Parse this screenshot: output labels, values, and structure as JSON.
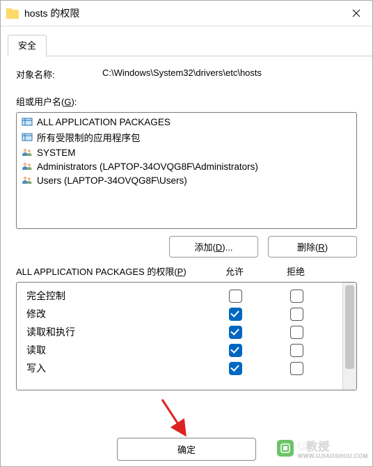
{
  "window": {
    "title": "hosts 的权限"
  },
  "tab": {
    "label": "安全"
  },
  "object": {
    "label": "对象名称:",
    "value": "C:\\Windows\\System32\\drivers\\etc\\hosts"
  },
  "group_label": {
    "pre": "组或用户名(",
    "mn": "G",
    "post": "):"
  },
  "principals": [
    {
      "icon": "pkg",
      "name": "ALL APPLICATION PACKAGES",
      "selected": true
    },
    {
      "icon": "pkg",
      "name": "所有受限制的应用程序包"
    },
    {
      "icon": "users",
      "name": "SYSTEM"
    },
    {
      "icon": "users",
      "name": "Administrators (LAPTOP-34OVQG8F\\Administrators)"
    },
    {
      "icon": "users",
      "name": "Users (LAPTOP-34OVQG8F\\Users)"
    }
  ],
  "buttons": {
    "add": {
      "pre": "添加(",
      "mn": "D",
      "post": ")..."
    },
    "remove": {
      "pre": "删除(",
      "mn": "R",
      "post": ")"
    },
    "ok": "确定"
  },
  "perm_header": {
    "label": {
      "pre": "ALL APPLICATION PACKAGES 的权限(",
      "mn": "P",
      "post": ")"
    },
    "allow": "允许",
    "deny": "拒绝"
  },
  "permissions": [
    {
      "name": "完全控制",
      "allow": false,
      "deny": false
    },
    {
      "name": "修改",
      "allow": true,
      "deny": false
    },
    {
      "name": "读取和执行",
      "allow": true,
      "deny": false
    },
    {
      "name": "读取",
      "allow": true,
      "deny": false
    },
    {
      "name": "写入",
      "allow": true,
      "deny": false
    }
  ],
  "watermark": {
    "brand": "U教授",
    "sub": "WWW.UJIAOSHOU.COM"
  }
}
